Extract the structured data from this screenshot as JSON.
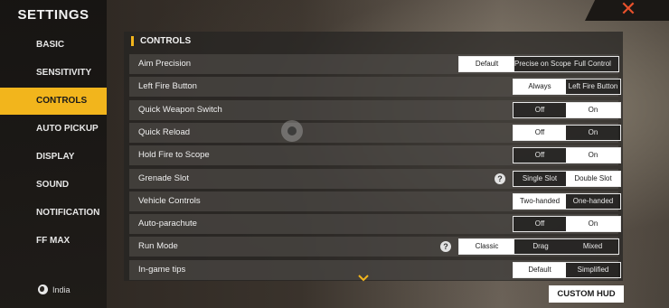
{
  "app": {
    "title": "SETTINGS"
  },
  "sidebar": {
    "items": [
      {
        "label": "BASIC",
        "active": false
      },
      {
        "label": "SENSITIVITY",
        "active": false
      },
      {
        "label": "CONTROLS",
        "active": true
      },
      {
        "label": "AUTO PICKUP",
        "active": false
      },
      {
        "label": "DISPLAY",
        "active": false
      },
      {
        "label": "SOUND",
        "active": false
      },
      {
        "label": "NOTIFICATION",
        "active": false
      },
      {
        "label": "FF MAX",
        "active": false
      }
    ],
    "region": "India"
  },
  "close": {
    "icon": "close-icon",
    "color": "#e8512c"
  },
  "controls": {
    "section_title": "CONTROLS",
    "rows": [
      {
        "label": "Aim Precision",
        "options": [
          "Default",
          "Precise on Scope",
          "Full Control"
        ],
        "selected": 0,
        "help": false
      },
      {
        "label": "Left Fire Button",
        "options": [
          "Always",
          "Left Fire Button"
        ],
        "selected": 0,
        "help": false
      },
      {
        "label": "Quick Weapon Switch",
        "options": [
          "Off",
          "On"
        ],
        "selected": 1,
        "help": false
      },
      {
        "label": "Quick Reload",
        "options": [
          "Off",
          "On"
        ],
        "selected": 0,
        "help": false
      },
      {
        "label": "Hold Fire to Scope",
        "options": [
          "Off",
          "On"
        ],
        "selected": 1,
        "help": false
      },
      {
        "label": "Grenade Slot",
        "options": [
          "Single Slot",
          "Double Slot"
        ],
        "selected": 1,
        "help": true
      },
      {
        "label": "Vehicle Controls",
        "options": [
          "Two-handed",
          "One-handed"
        ],
        "selected": 0,
        "help": false
      },
      {
        "label": "Auto-parachute",
        "options": [
          "Off",
          "On"
        ],
        "selected": 1,
        "help": false
      },
      {
        "label": "Run Mode",
        "options": [
          "Classic",
          "Drag",
          "Mixed"
        ],
        "selected": 0,
        "help": true
      },
      {
        "label": "In-game tips",
        "options": [
          "Default",
          "Simplified"
        ],
        "selected": 0,
        "help": false
      }
    ]
  },
  "footer": {
    "custom_hud_label": "CUSTOM HUD"
  },
  "colors": {
    "accent": "#f2b51c",
    "selected_bg": "#ffffff"
  }
}
